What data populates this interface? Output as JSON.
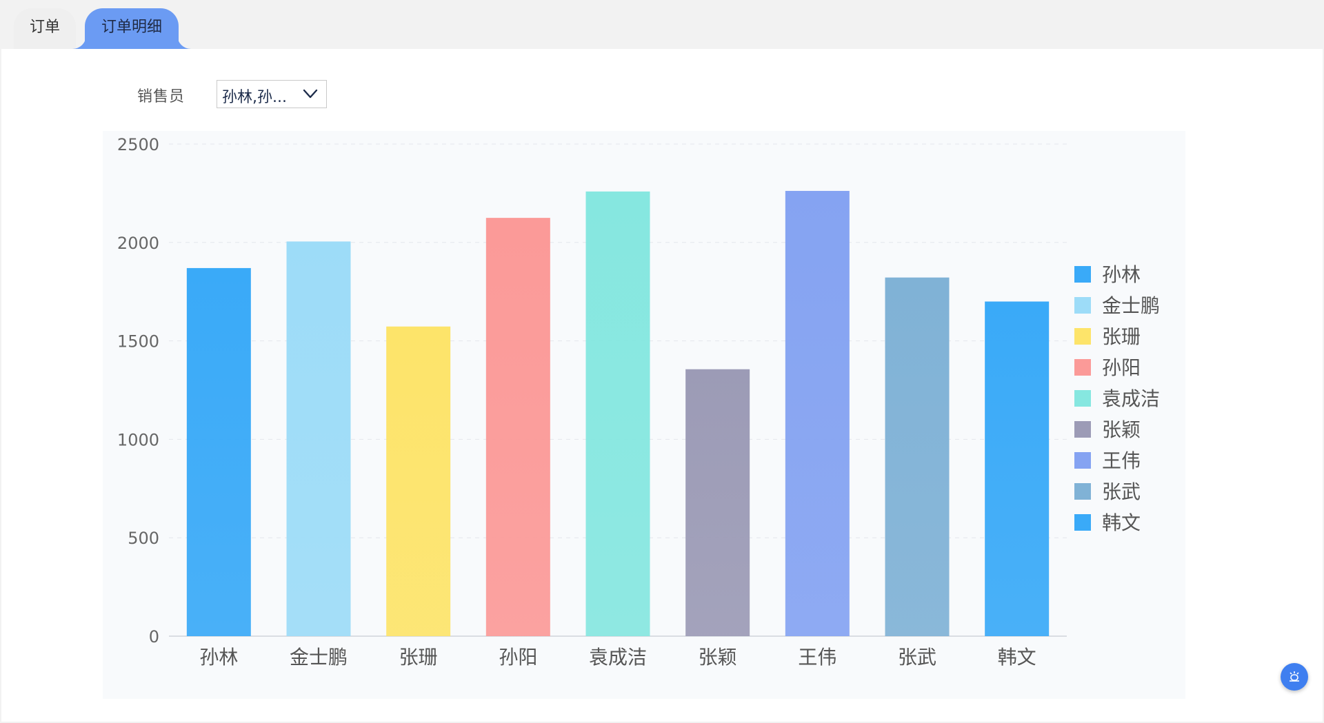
{
  "tabs": [
    {
      "label": "订单",
      "active": false
    },
    {
      "label": "订单明细",
      "active": true
    }
  ],
  "filter": {
    "label": "销售员",
    "selected_value": "孙林,孙..."
  },
  "colors": {
    "accent": "#6b9bf3",
    "float_button": "#3f7ff0"
  },
  "float_button": {
    "icon": "alarm-icon"
  },
  "chart_data": {
    "type": "bar",
    "categories": [
      "孙林",
      "金士鹏",
      "张珊",
      "孙阳",
      "袁成洁",
      "张颖",
      "王伟",
      "张武",
      "韩文"
    ],
    "values": [
      1870,
      2005,
      1573,
      2125,
      2259,
      1356,
      2262,
      1822,
      1700
    ],
    "colors": [
      "#3aaaf8",
      "#9ddcf8",
      "#fde46a",
      "#fb9a98",
      "#86e7e0",
      "#9c9bb6",
      "#85a3f2",
      "#80b2d6",
      "#3aaaf8"
    ],
    "ylim": [
      0,
      2500
    ],
    "yticks": [
      0,
      500,
      1000,
      1500,
      2000,
      2500
    ],
    "grid": true,
    "legend": {
      "position": "right",
      "entries": [
        "孙林",
        "金士鹏",
        "张珊",
        "孙阳",
        "袁成洁",
        "张颖",
        "王伟",
        "张武",
        "韩文"
      ]
    }
  }
}
